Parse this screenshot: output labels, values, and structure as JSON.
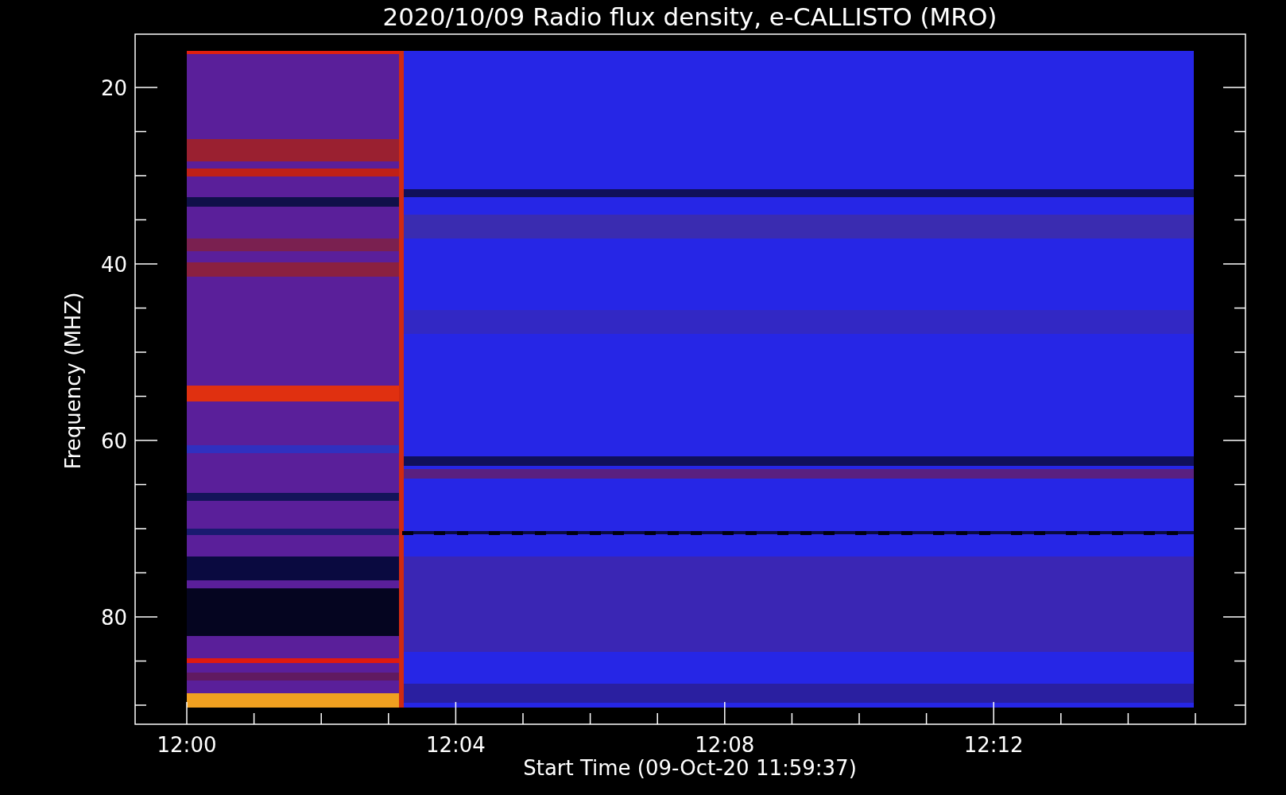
{
  "title": "2020/10/09  Radio flux density, e-CALLISTO (MRO)",
  "y_axis": {
    "label": "Frequency (MHZ)",
    "ticks": [
      "20",
      "40",
      "60",
      "80"
    ]
  },
  "x_axis": {
    "label": "Start Time (09-Oct-20 11:59:37)",
    "ticks": [
      "12:00",
      "12:04",
      "12:08",
      "12:12"
    ]
  }
}
